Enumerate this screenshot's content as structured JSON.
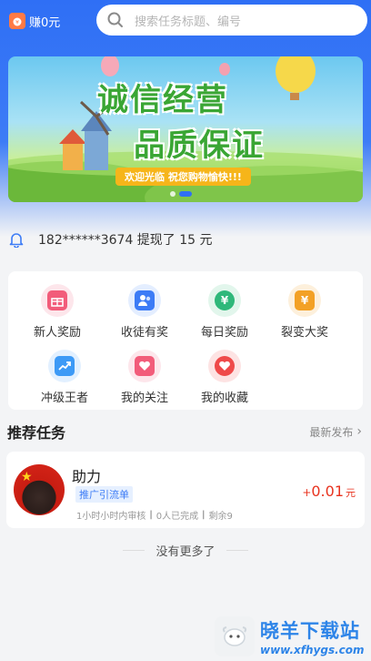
{
  "colors": {
    "accent": "#2f6ff5",
    "price": "#e8321e",
    "tag_bg": "#e6f0ff"
  },
  "header": {
    "earn_label": "赚0元",
    "search_placeholder": "搜索任务标题、编号"
  },
  "banner": {
    "title_line1": "诚信经营",
    "title_line2": "品质保证",
    "ribbon": "欢迎光临 祝您购物愉快!!!",
    "page_index": 2,
    "page_count": 2
  },
  "notice": {
    "text": "182******3674 提现了 15 元"
  },
  "grid": {
    "items": [
      {
        "label": "新人奖励",
        "icon": "gift-icon",
        "color": "#f25c7a"
      },
      {
        "label": "收徒有奖",
        "icon": "users-icon",
        "color": "#3d7cf6"
      },
      {
        "label": "每日奖励",
        "icon": "yuan-coin-icon",
        "color": "#2fb87a"
      },
      {
        "label": "裂变大奖",
        "icon": "yuan-bag-icon",
        "color": "#f3a126"
      },
      {
        "label": "冲级王者",
        "icon": "trend-up-icon",
        "color": "#3d9af6"
      },
      {
        "label": "我的关注",
        "icon": "hearts-icon",
        "color": "#f25c7a"
      },
      {
        "label": "我的收藏",
        "icon": "heart-icon",
        "color": "#ef4a4a"
      }
    ]
  },
  "section": {
    "title": "推荐任务",
    "sort_label": "最新发布"
  },
  "task": {
    "name": "助力",
    "tag": "推广引流单",
    "review_time": "1小时小时内审核",
    "completed": "0人已完成",
    "remaining": "剩余9",
    "price_sign": "+",
    "price_amount": "0.01",
    "price_unit": "元"
  },
  "footer": {
    "no_more": "没有更多了"
  },
  "watermark": {
    "title": "晓羊下载站",
    "url": "www.xfhygs.com"
  }
}
